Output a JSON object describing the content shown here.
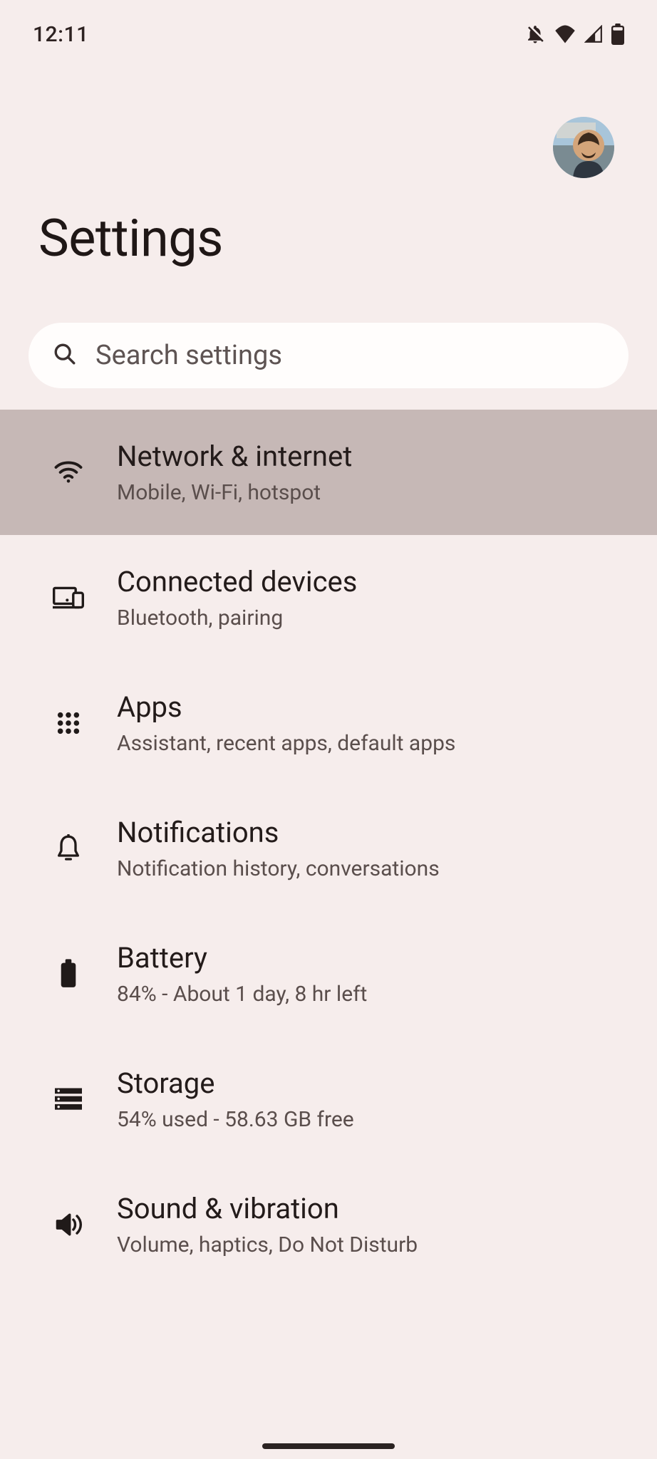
{
  "status": {
    "time": "12:11"
  },
  "page": {
    "title": "Settings"
  },
  "search": {
    "placeholder": "Search settings"
  },
  "items": [
    {
      "title": "Network & internet",
      "subtitle": "Mobile, Wi-Fi, hotspot"
    },
    {
      "title": "Connected devices",
      "subtitle": "Bluetooth, pairing"
    },
    {
      "title": "Apps",
      "subtitle": "Assistant, recent apps, default apps"
    },
    {
      "title": "Notifications",
      "subtitle": "Notification history, conversations"
    },
    {
      "title": "Battery",
      "subtitle": "84% - About 1 day, 8 hr left"
    },
    {
      "title": "Storage",
      "subtitle": "54% used - 58.63 GB free"
    },
    {
      "title": "Sound & vibration",
      "subtitle": "Volume, haptics, Do Not Disturb"
    }
  ]
}
